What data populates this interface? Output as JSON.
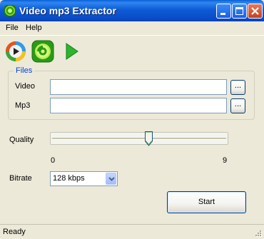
{
  "window": {
    "title": "Video mp3 Extractor"
  },
  "menu": [
    "File",
    "Help"
  ],
  "toolbar": {
    "icons": [
      "media-player-icon",
      "extractor-logo-icon",
      "play-icon"
    ]
  },
  "files_group": {
    "legend": "Files",
    "video_label": "Video",
    "video_value": "",
    "mp3_label": "Mp3",
    "mp3_value": "",
    "browse_label": "..."
  },
  "quality": {
    "label": "Quality",
    "min_label": "0",
    "max_label": "9",
    "min": 0,
    "max": 9,
    "value": 5
  },
  "bitrate": {
    "label": "Bitrate",
    "selected": "128 kbps"
  },
  "start_button": "Start",
  "status": "Ready",
  "colors": {
    "titlebar": "#0A4FC9",
    "group_legend": "#0046D5",
    "window_bg": "#ECE9D8"
  }
}
